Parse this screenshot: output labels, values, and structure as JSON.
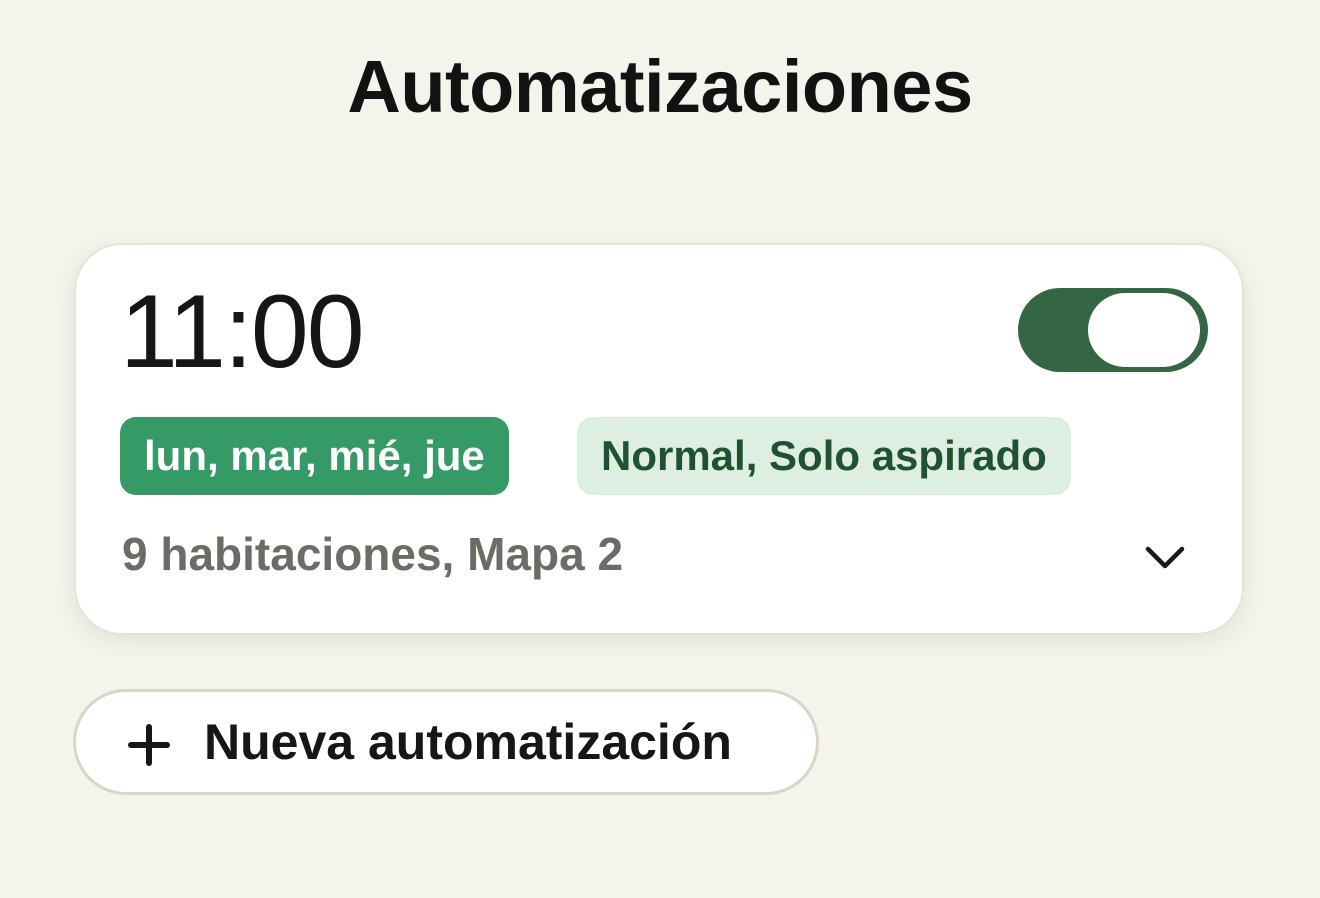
{
  "page": {
    "title": "Automatizaciones"
  },
  "automation": {
    "time": "11:00",
    "enabled": true,
    "days_chip": "lun, mar, mié, jue",
    "mode_chip": "Normal, Solo aspirado",
    "details": "9 habitaciones, Mapa 2"
  },
  "new_automation": {
    "label": "Nueva automatización",
    "icon": "plus-icon"
  },
  "colors": {
    "background": "#f4f3ec",
    "card": "#ffffff",
    "toggle_on": "#346644",
    "chip_days": "#359a66",
    "chip_mode_bg": "#dfeee3",
    "chip_mode_text": "#1f5230",
    "muted_text": "#6e6b66"
  },
  "icons": {
    "expand": "chevron-down-icon",
    "add": "plus-icon"
  }
}
